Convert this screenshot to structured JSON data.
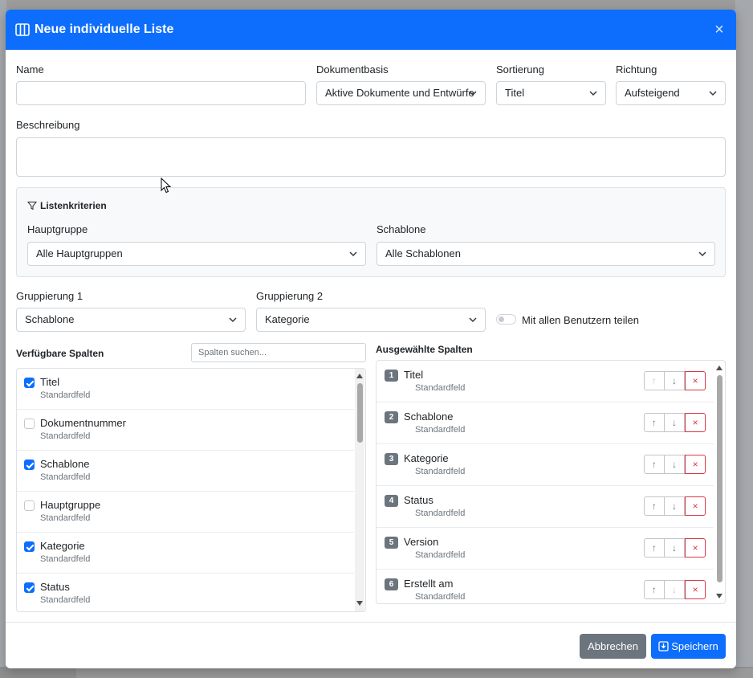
{
  "modal": {
    "title": "Neue individuelle Liste",
    "close_symbol": "×"
  },
  "form": {
    "name_label": "Name",
    "name_value": "",
    "dokumentbasis_label": "Dokumentbasis",
    "dokumentbasis_value": "Aktive Dokumente und Entwürfe",
    "sortierung_label": "Sortierung",
    "sortierung_value": "Titel",
    "richtung_label": "Richtung",
    "richtung_value": "Aufsteigend",
    "beschreibung_label": "Beschreibung",
    "beschreibung_value": ""
  },
  "criteria": {
    "heading": "Listenkriterien",
    "hauptgruppe_label": "Hauptgruppe",
    "hauptgruppe_value": "Alle Hauptgruppen",
    "schablone_label": "Schablone",
    "schablone_value": "Alle Schablonen"
  },
  "grouping": {
    "g1_label": "Gruppierung 1",
    "g1_value": "Schablone",
    "g2_label": "Gruppierung 2",
    "g2_value": "Kategorie",
    "share_label": "Mit allen Benutzern teilen",
    "share_enabled": false
  },
  "available": {
    "heading": "Verfügbare Spalten",
    "search_placeholder": "Spalten suchen...",
    "items": [
      {
        "title": "Titel",
        "sub": "Standardfeld",
        "checked": true
      },
      {
        "title": "Dokumentnummer",
        "sub": "Standardfeld",
        "checked": false
      },
      {
        "title": "Schablone",
        "sub": "Standardfeld",
        "checked": true
      },
      {
        "title": "Hauptgruppe",
        "sub": "Standardfeld",
        "checked": false
      },
      {
        "title": "Kategorie",
        "sub": "Standardfeld",
        "checked": true
      },
      {
        "title": "Status",
        "sub": "Standardfeld",
        "checked": true
      }
    ]
  },
  "selected": {
    "heading": "Ausgewählte Spalten",
    "items": [
      {
        "num": "1",
        "title": "Titel",
        "sub": "Standardfeld"
      },
      {
        "num": "2",
        "title": "Schablone",
        "sub": "Standardfeld"
      },
      {
        "num": "3",
        "title": "Kategorie",
        "sub": "Standardfeld"
      },
      {
        "num": "4",
        "title": "Status",
        "sub": "Standardfeld"
      },
      {
        "num": "5",
        "title": "Version",
        "sub": "Standardfeld"
      },
      {
        "num": "6",
        "title": "Erstellt am",
        "sub": "Standardfeld"
      }
    ],
    "up_symbol": "↑",
    "down_symbol": "↓",
    "remove_symbol": "×"
  },
  "footer": {
    "cancel_label": "Abbrechen",
    "save_label": "Speichern"
  },
  "colors": {
    "primary": "#0d6efd",
    "secondary": "#6c757d",
    "danger": "#dc3545"
  }
}
